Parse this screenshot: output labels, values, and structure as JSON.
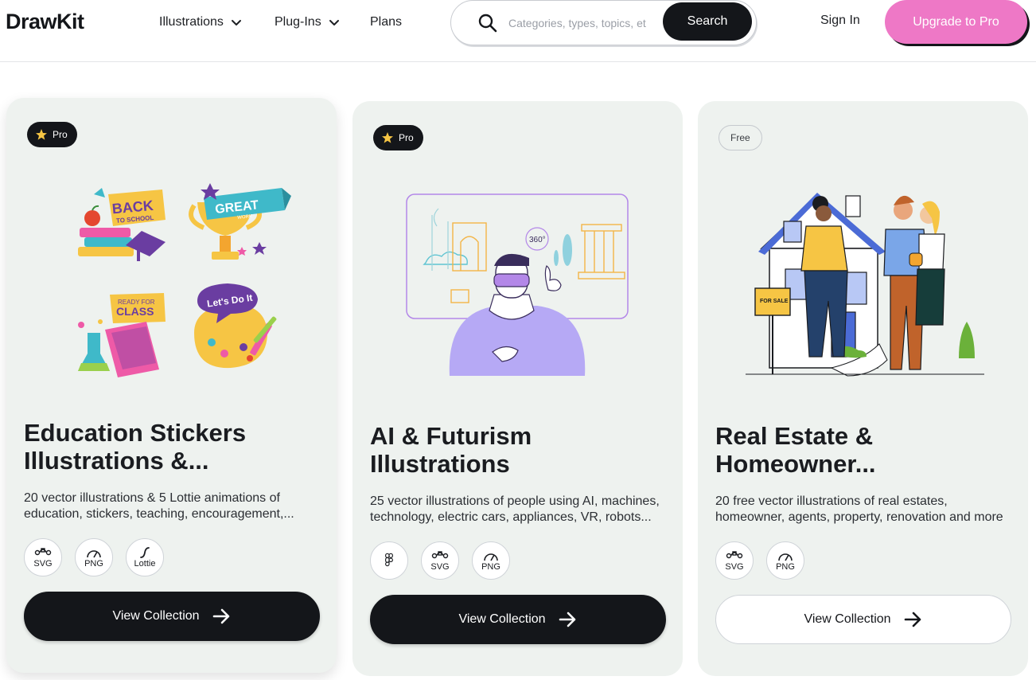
{
  "header": {
    "logo": "DrawKit",
    "nav": [
      {
        "label": "Illustrations",
        "has_dropdown": true
      },
      {
        "label": "Plug-Ins",
        "has_dropdown": true
      },
      {
        "label": "Plans",
        "has_dropdown": false
      }
    ],
    "search": {
      "placeholder": "Categories, types, topics, et",
      "button_label": "Search"
    },
    "signin_label": "Sign In",
    "upgrade_label": "Upgrade to Pro"
  },
  "cards": [
    {
      "badge": "Pro",
      "title": "Education Stickers Illustrations &...",
      "description": "20 vector illustrations & 5 Lottie animations of education, stickers, teaching, encouragement,...",
      "formats": [
        "SVG",
        "PNG",
        "Lottie"
      ],
      "button_label": "View Collection",
      "sticker_texts": [
        "BACK",
        "TO SCHOOL",
        "GREAT",
        "WORK",
        "READY FOR",
        "CLASS",
        "Let's Do It"
      ]
    },
    {
      "badge": "Pro",
      "title": "AI & Futurism Illustrations",
      "description": "25 vector illustrations of people using AI, machines, technology, electric cars, appliances, VR, robots...",
      "formats": [
        "",
        "SVG",
        "PNG"
      ],
      "button_label": "View Collection",
      "art_label": "360°"
    },
    {
      "badge": "Free",
      "title": "Real Estate & Homeowner...",
      "description": "20 free vector illustrations of real estates, homeowner, agents, property, renovation and more",
      "formats": [
        "SVG",
        "PNG"
      ],
      "button_label": "View Collection",
      "sign_text": "FOR SALE"
    }
  ],
  "colors": {
    "dark": "#14161a",
    "accent_pink": "#ee78c6",
    "card_bg": "#eef2ef"
  },
  "icons": [
    "search-icon",
    "chevron-down-icon",
    "star-icon",
    "arrow-right-icon",
    "svg-format-icon",
    "png-format-icon",
    "lottie-format-icon",
    "figma-icon"
  ]
}
